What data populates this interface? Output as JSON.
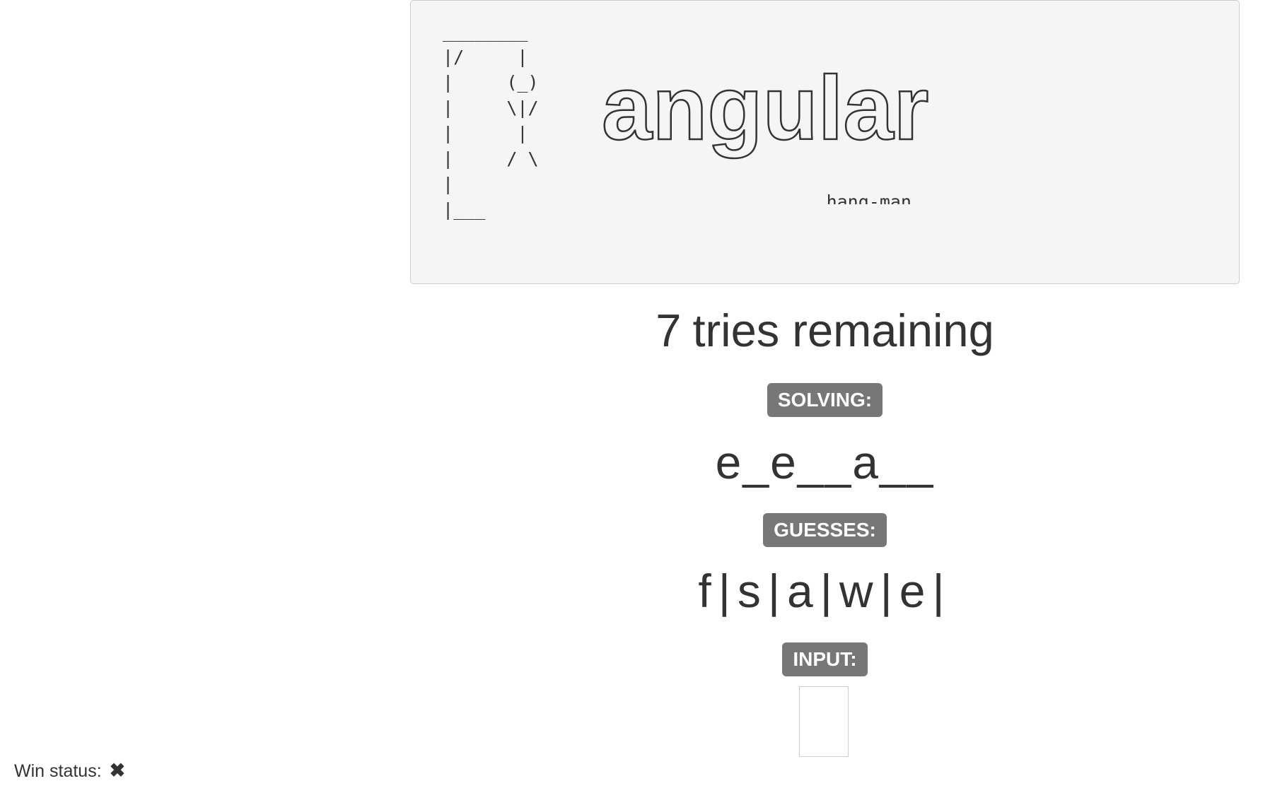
{
  "ascii_art": " ________\n |/     |\n |     (_)\n |     \\|/\n |      |\n |     / \\\n |\n |___",
  "logo": {
    "title": "angular",
    "subtitle": "hang-man"
  },
  "status": {
    "tries_remaining": 7,
    "tries_text": "tries remaining"
  },
  "labels": {
    "solving": "SOLVING:",
    "guesses": "GUESSES:",
    "input": "INPUT:"
  },
  "word_progress": "e_e__a__",
  "guesses": [
    "f",
    "s",
    "a",
    "w",
    "e"
  ],
  "input": {
    "value": "",
    "placeholder": ""
  },
  "win_status": {
    "label": "Win status:",
    "icon": "x-mark-icon",
    "icon_glyph": "✖",
    "won": false
  }
}
